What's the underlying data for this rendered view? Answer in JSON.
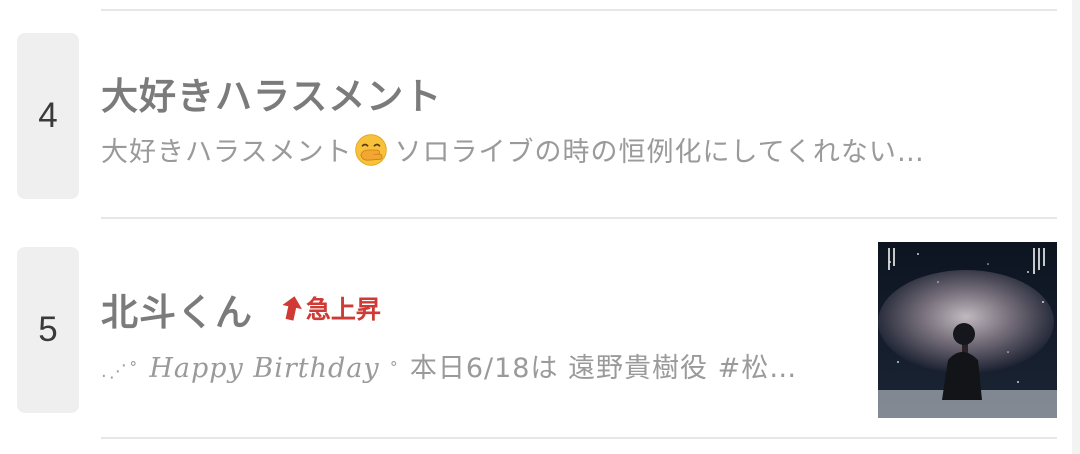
{
  "ranking": [
    {
      "rank": "4",
      "title": "大好きハラスメント",
      "snippet_before_emoji": "大好きハラスメント",
      "emoji": "hand-over-mouth-emoji",
      "snippet_after_emoji": "ソロライブの時の恒例化にしてくれない…"
    },
    {
      "rank": "5",
      "title": "北斗くん",
      "badge": "急上昇",
      "badge_icon": "arrow-up-icon",
      "badge_color": "#cf3a34",
      "snippet_lead": ".⋰˚",
      "snippet_italic": "Happy Birthday",
      "snippet_mid": "˚",
      "snippet_tail": "本日6/18は 遠野貴樹役 #松…",
      "thumbnail": "movie-poster-thumbnail"
    }
  ]
}
